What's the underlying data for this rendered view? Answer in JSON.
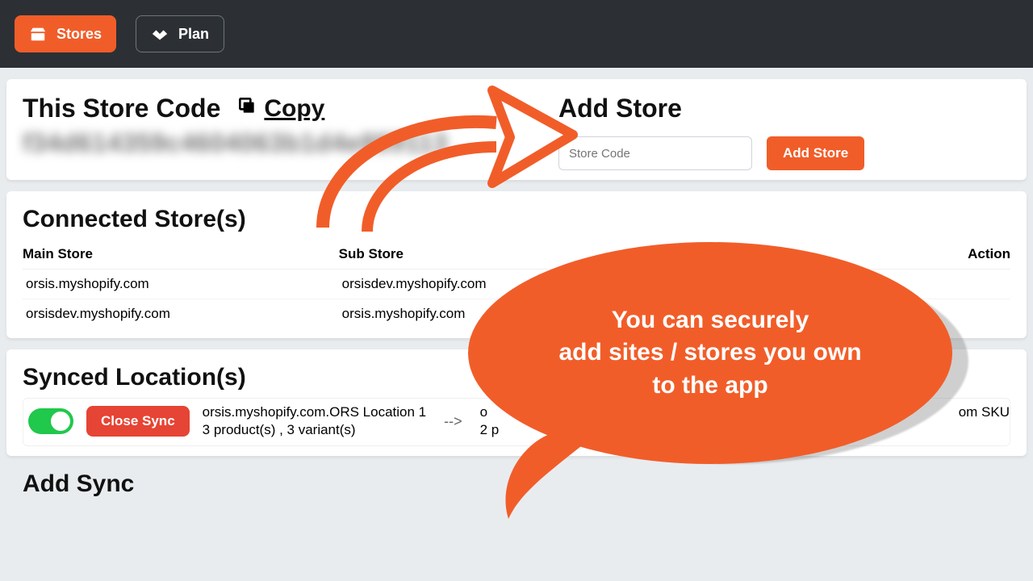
{
  "nav": {
    "stores": "Stores",
    "plan": "Plan"
  },
  "storeCode": {
    "title": "This Store Code",
    "copy": "Copy",
    "masked": "f34d614359c4604063b1d4e889113"
  },
  "addStore": {
    "title": "Add Store",
    "placeholder": "Store Code",
    "button": "Add Store"
  },
  "connected": {
    "title": "Connected Store(s)",
    "headers": {
      "main": "Main Store",
      "sub": "Sub Store",
      "action": "Action"
    },
    "rows": [
      {
        "main": "orsis.myshopify.com",
        "sub": "orsisdev.myshopify.com"
      },
      {
        "main": "orsisdev.myshopify.com",
        "sub": "orsis.myshopify.com"
      }
    ]
  },
  "synced": {
    "title": "Synced Location(s)",
    "closeBtn": "Close Sync",
    "left_l1": "orsis.myshopify.com.ORS Location 1",
    "left_l2": "3 product(s) , 3 variant(s)",
    "arrow": "-->",
    "right_l1_start": "o",
    "right_l2_start": "2 p",
    "right_l1_end": "om SKU"
  },
  "addSync": {
    "title": "Add Sync"
  },
  "bubble": {
    "l1": "You can securely",
    "l2": "add sites / stores you own",
    "l3": "to the app"
  }
}
